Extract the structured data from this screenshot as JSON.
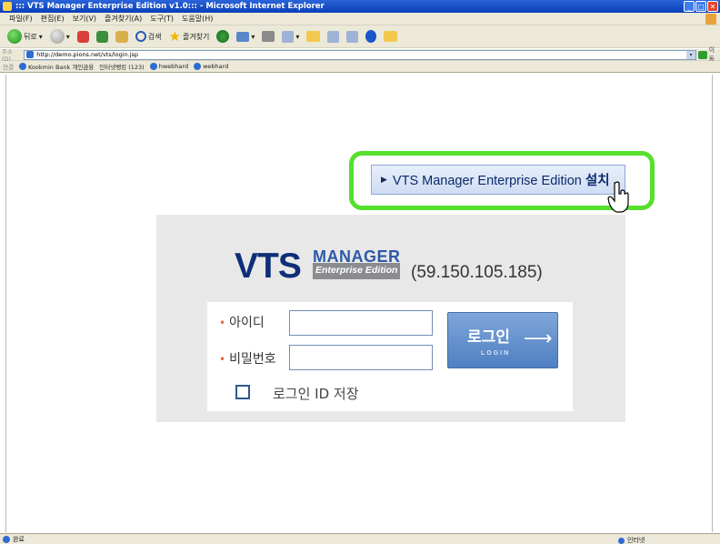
{
  "window": {
    "title": "::: VTS Manager Enterprise Edition v1.0::: - Microsoft Internet Explorer",
    "controls": [
      "_",
      "□",
      "✕"
    ]
  },
  "menubar": {
    "items": [
      "파일(F)",
      "편집(E)",
      "보기(V)",
      "즐겨찾기(A)",
      "도구(T)",
      "도움말(H)"
    ]
  },
  "toolbar": {
    "back_label": "뒤로",
    "search_label": "검색",
    "favorites_label": "즐겨찾기"
  },
  "address": {
    "label": "주소(D)",
    "url": "http://demo.pions.net/vts/login.jsp",
    "go_label": "이동"
  },
  "links": {
    "label": "연결",
    "items": [
      "Kookmin Bank 개인금융",
      "인터넷뱅킹 (123)",
      "hwebhard",
      "webhard"
    ]
  },
  "install": {
    "label_main": "VTS Manager Enterprise Edition",
    "label_action": "설치"
  },
  "login": {
    "logo_vts": "VTS",
    "logo_manager": "MANAGER",
    "logo_edition": "Enterprise Edition",
    "server_ip": "(59.150.105.185)",
    "id_label": "아이디",
    "id_value": "",
    "password_label": "비밀번호",
    "password_value": "",
    "button_label": "로그인",
    "button_sub": "LOGIN",
    "save_id_label": "로그인 ID 저장",
    "save_id_checked": false
  },
  "status": {
    "text": "완료",
    "zone": "인터넷"
  },
  "colors": {
    "highlight": "#55e02d",
    "brand_navy": "#0e2f78",
    "login_button": "#5b88c8"
  }
}
